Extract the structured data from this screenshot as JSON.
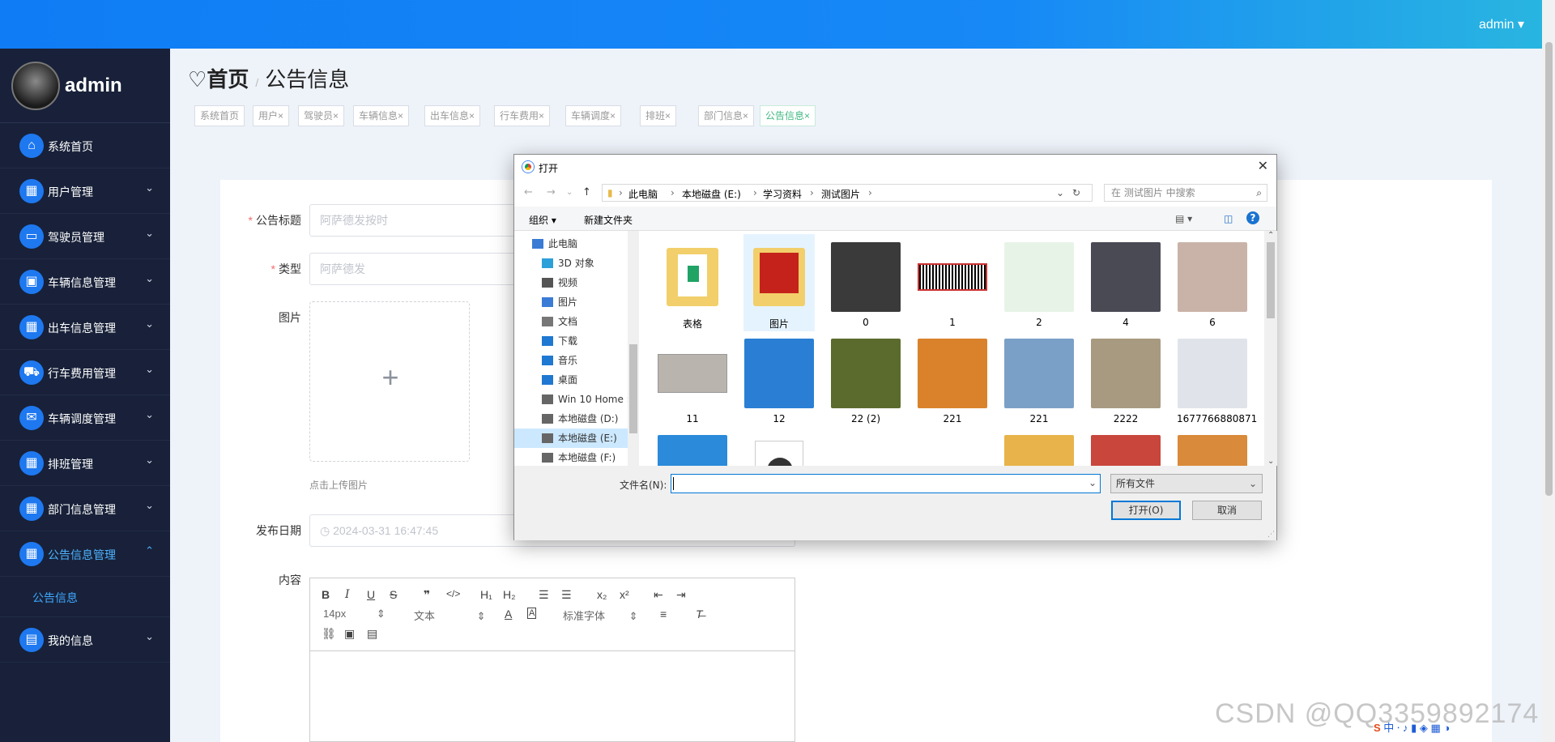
{
  "header": {
    "user": "admin",
    "dropdown_icon": "caret-down"
  },
  "sidebar": {
    "username": "admin",
    "items": [
      {
        "label": "系统首页",
        "icon": "home-icon",
        "expandable": false
      },
      {
        "label": "用户管理",
        "icon": "grid-icon",
        "expandable": true
      },
      {
        "label": "驾驶员管理",
        "icon": "monitor-icon",
        "expandable": true
      },
      {
        "label": "车辆信息管理",
        "icon": "briefcase-icon",
        "expandable": true
      },
      {
        "label": "出车信息管理",
        "icon": "grid-icon",
        "expandable": true
      },
      {
        "label": "行车费用管理",
        "icon": "car-icon",
        "expandable": true
      },
      {
        "label": "车辆调度管理",
        "icon": "chat-icon",
        "expandable": true
      },
      {
        "label": "排班管理",
        "icon": "grid-icon",
        "expandable": true
      },
      {
        "label": "部门信息管理",
        "icon": "grid-icon",
        "expandable": true
      },
      {
        "label": "公告信息管理",
        "icon": "grid-icon",
        "expandable": true,
        "expanded": true,
        "active": true
      },
      {
        "label": "我的信息",
        "icon": "card-icon",
        "expandable": true
      }
    ],
    "submenu": {
      "label": "公告信息"
    }
  },
  "breadcrumb": {
    "home": "首页",
    "separator": "/",
    "current": "公告信息"
  },
  "tags": [
    {
      "label": "系统首页",
      "closable": false
    },
    {
      "label": "用户",
      "closable": true
    },
    {
      "label": "驾驶员",
      "closable": true
    },
    {
      "label": "车辆信息",
      "closable": true
    },
    {
      "label": "出车信息",
      "closable": true
    },
    {
      "label": "行车费用",
      "closable": true
    },
    {
      "label": "车辆调度",
      "closable": true
    },
    {
      "label": "排班",
      "closable": true
    },
    {
      "label": "部门信息",
      "closable": true
    },
    {
      "label": "公告信息",
      "closable": true,
      "active": true
    }
  ],
  "form": {
    "title_label": "公告标题",
    "title_placeholder": "阿萨德发按时",
    "type_label": "类型",
    "type_placeholder": "阿萨德发",
    "image_label": "图片",
    "upload_tip": "点击上传图片",
    "date_label": "发布日期",
    "date_value": "2024-03-31 16:47:45",
    "content_label": "内容",
    "editor": {
      "font_size": "14px",
      "block": "文本",
      "font": "标准字体"
    }
  },
  "dialog": {
    "title": "打开",
    "path": [
      "此电脑",
      "本地磁盘 (E:)",
      "学习资料",
      "测试图片"
    ],
    "search_placeholder": "在 测试图片 中搜索",
    "organize": "组织 ▾",
    "new_folder": "新建文件夹",
    "nav": [
      {
        "label": "此电脑",
        "level": 0
      },
      {
        "label": "3D 对象",
        "level": 1
      },
      {
        "label": "视频",
        "level": 1
      },
      {
        "label": "图片",
        "level": 1
      },
      {
        "label": "文档",
        "level": 1
      },
      {
        "label": "下载",
        "level": 1
      },
      {
        "label": "音乐",
        "level": 1
      },
      {
        "label": "桌面",
        "level": 1
      },
      {
        "label": "Win 10 Home ›",
        "level": 1
      },
      {
        "label": "本地磁盘 (D:)",
        "level": 1
      },
      {
        "label": "本地磁盘 (E:)",
        "level": 1,
        "selected": true
      },
      {
        "label": "本地磁盘 (F:)",
        "level": 1
      }
    ],
    "files": [
      {
        "name": "表格",
        "kind": "folder-doc"
      },
      {
        "name": "图片",
        "kind": "folder-img",
        "selected": true
      },
      {
        "name": "0",
        "kind": "portrait",
        "color": "#3a3a3a"
      },
      {
        "name": "1",
        "kind": "barcode",
        "color": "#ffffff"
      },
      {
        "name": "2",
        "kind": "plant",
        "color": "#e8f3e8"
      },
      {
        "name": "4",
        "kind": "portrait",
        "color": "#4a4a55"
      },
      {
        "name": "6",
        "kind": "portrait",
        "color": "#c9b3a8"
      },
      {
        "name": "11",
        "kind": "card",
        "color": "#b9b4ad"
      },
      {
        "name": "12",
        "kind": "portrait-blue",
        "color": "#2a7fd4"
      },
      {
        "name": "22 (2)",
        "kind": "beetle",
        "color": "#5b6b2d"
      },
      {
        "name": "221",
        "kind": "veg",
        "color": "#d9822b"
      },
      {
        "name": "221",
        "kind": "beetle2",
        "color": "#7aa0c8"
      },
      {
        "name": "2222",
        "kind": "bottles",
        "color": "#a89a80"
      },
      {
        "name": "1677766880871",
        "kind": "plane",
        "color": "#e0e4ea"
      },
      {
        "name": "",
        "kind": "app",
        "color": "#2b8ad9"
      },
      {
        "name": "",
        "kind": "video",
        "color": "#f0f0f0"
      },
      {
        "name": "",
        "kind": "blank",
        "color": "#ffffff"
      },
      {
        "name": "",
        "kind": "doc",
        "color": "#ffffff"
      },
      {
        "name": "",
        "kind": "food",
        "color": "#e8b34a"
      },
      {
        "name": "",
        "kind": "food2",
        "color": "#c8463c"
      },
      {
        "name": "",
        "kind": "food3",
        "color": "#d98a3a"
      }
    ],
    "filename_label": "文件名(N):",
    "filename_value": "",
    "filetype": "所有文件",
    "open_btn": "打开(O)",
    "cancel_btn": "取消"
  },
  "watermark": "CSDN @QQ3359892174",
  "tray": "中 ⸱ ♪ ▮ ◈ ▦ ◑"
}
